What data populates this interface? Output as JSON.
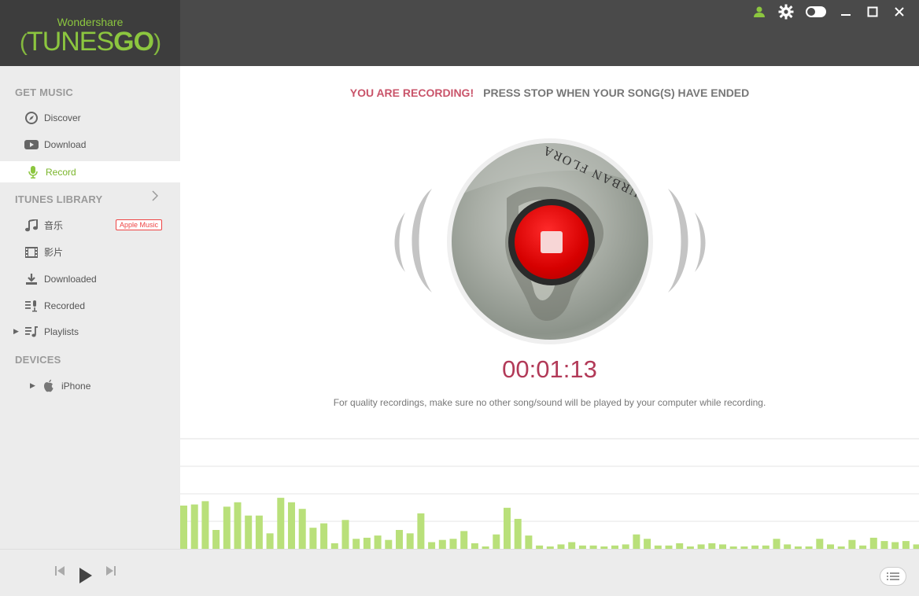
{
  "app": {
    "brand": "Wondershare",
    "name_left": "TUNES",
    "name_right": "GO"
  },
  "colors": {
    "accent": "#8cc63f",
    "record_red": "#d60000",
    "timer": "#b23a58"
  },
  "window_controls": [
    "user-icon",
    "gear-icon",
    "toggle-icon",
    "minimize-icon",
    "maximize-icon",
    "close-icon"
  ],
  "sidebar": {
    "get_music": {
      "heading": "GET MUSIC",
      "items": [
        {
          "label": "Discover",
          "icon": "compass-icon"
        },
        {
          "label": "Download",
          "icon": "youtube-icon"
        },
        {
          "label": "Record",
          "icon": "microphone-icon",
          "active": true
        }
      ]
    },
    "itunes_library": {
      "heading": "ITUNES LIBRARY",
      "items": [
        {
          "label": "音乐",
          "icon": "music-note-icon",
          "badge": "Apple Music"
        },
        {
          "label": "影片",
          "icon": "film-icon"
        },
        {
          "label": "Downloaded",
          "icon": "download-icon"
        },
        {
          "label": "Recorded",
          "icon": "recorded-icon"
        },
        {
          "label": "Playlists",
          "icon": "playlist-icon"
        }
      ]
    },
    "devices": {
      "heading": "DEVICES",
      "items": [
        {
          "label": "iPhone",
          "icon": "apple-icon"
        }
      ]
    }
  },
  "main": {
    "recording_warning": "YOU ARE RECORDING!",
    "recording_instruction": "PRESS STOP WHEN YOUR SONG(S) HAVE ENDED",
    "album_art_text": "URBAN FLORA",
    "timer": "00:01:13",
    "quality_note": "For quality recordings, make sure no other song/sound will be played by your computer while recording."
  },
  "visualizer": {
    "levels": [
      0.39,
      0.4,
      0.43,
      0.17,
      0.38,
      0.42,
      0.3,
      0.3,
      0.14,
      0.46,
      0.42,
      0.36,
      0.19,
      0.23,
      0.05,
      0.26,
      0.09,
      0.1,
      0.12,
      0.08,
      0.17,
      0.14,
      0.32,
      0.06,
      0.08,
      0.09,
      0.16,
      0.05,
      0.01,
      0.13,
      0.37,
      0.27,
      0.12,
      0.03,
      0.01,
      0.04,
      0.06,
      0.03,
      0.03,
      0.01,
      0.03,
      0.04,
      0.13,
      0.09,
      0.03,
      0.03,
      0.05,
      0.02,
      0.04,
      0.05,
      0.04,
      0.02,
      0.02,
      0.03,
      0.03,
      0.09,
      0.04,
      0.02,
      0.01,
      0.09,
      0.04,
      0.01,
      0.08,
      0.03,
      0.1,
      0.07,
      0.06,
      0.07,
      0.04,
      0.06,
      0.04
    ]
  }
}
